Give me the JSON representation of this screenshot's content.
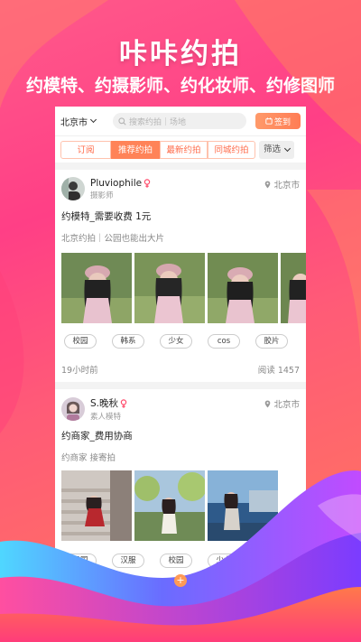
{
  "banner": {
    "title": "咔咔约拍",
    "subtitle": "约模特、约摄影师、约化妆师、约修图师"
  },
  "topbar": {
    "city": "北京市",
    "search_placeholder": "搜索约拍｜场地",
    "sign_in_label": "签到"
  },
  "tabs": [
    {
      "label": "订阅",
      "active": false
    },
    {
      "label": "推荐约拍",
      "active": true
    },
    {
      "label": "最新约拍",
      "active": false
    },
    {
      "label": "同城约拍",
      "active": false
    }
  ],
  "filter_label": "筛选",
  "posts": [
    {
      "user": "Pluviophile",
      "gender": "female",
      "role": "摄影师",
      "location": "北京市",
      "title": "约模特_需要收费 1元",
      "desc": "北京约拍｜公园也能出大片",
      "tags": [
        "校园",
        "韩系",
        "少女",
        "cos",
        "胶片"
      ],
      "time": "19小时前",
      "reads": "阅读 1457"
    },
    {
      "user": "S.晚秋",
      "gender": "female",
      "role": "素人模特",
      "location": "北京市",
      "title": "约商家_费用协商",
      "desc": "约商家 接寄拍",
      "tags": [
        "民国",
        "汉服",
        "校园",
        "少女"
      ]
    }
  ],
  "colors": {
    "accent": "#ff8358",
    "banner_bg": "#ff4f86",
    "female": "#ff4a6a"
  },
  "icons": [
    "search-icon",
    "calendar-icon",
    "location-pin-icon",
    "female-icon",
    "chevron-down-icon",
    "plus-icon"
  ]
}
